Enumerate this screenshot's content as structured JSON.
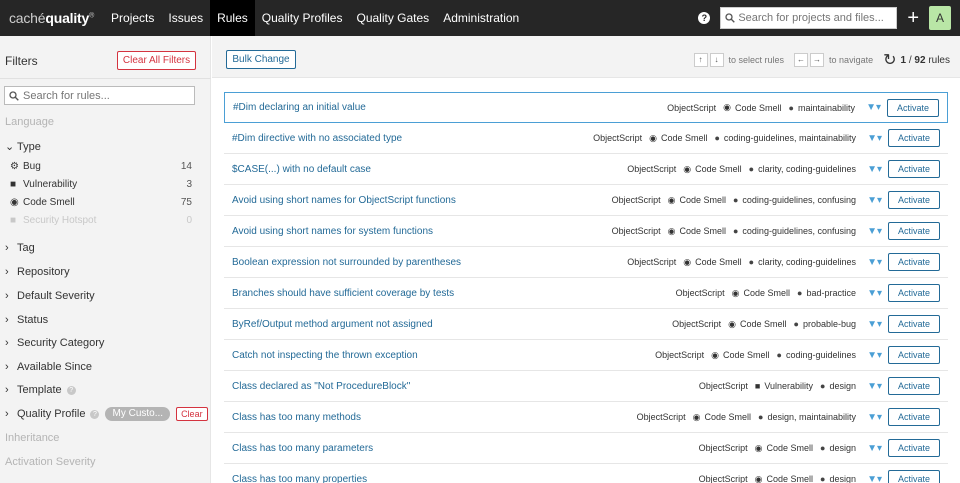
{
  "nav": {
    "logo_light": "caché",
    "logo_bold": "quality",
    "logo_sup": "®",
    "links": [
      "Projects",
      "Issues",
      "Rules",
      "Quality Profiles",
      "Quality Gates",
      "Administration"
    ],
    "active": "Rules",
    "search_placeholder": "Search for projects and files...",
    "help_icon": "?",
    "plus_icon": "+",
    "avatar_letter": "A"
  },
  "sidebar": {
    "filters_label": "Filters",
    "clear_all_label": "Clear All Filters",
    "search_placeholder": "Search for rules...",
    "language_label": "Language",
    "type_label": "Type",
    "type_items": [
      {
        "label": "Bug",
        "count": "14",
        "icon": "bug-icon"
      },
      {
        "label": "Vulnerability",
        "count": "3",
        "icon": "lock-icon"
      },
      {
        "label": "Code Smell",
        "count": "75",
        "icon": "code-smell-icon"
      },
      {
        "label": "Security Hotspot",
        "count": "0",
        "icon": "hotspot-icon"
      }
    ],
    "tag_label": "Tag",
    "repository_label": "Repository",
    "default_severity_label": "Default Severity",
    "status_label": "Status",
    "security_category_label": "Security Category",
    "available_since_label": "Available Since",
    "template_label": "Template",
    "quality_profile_label": "Quality Profile",
    "quality_profile_value": "My Custo...",
    "quality_profile_clear": "Clear",
    "inheritance_label": "Inheritance",
    "activation_severity_label": "Activation Severity"
  },
  "toolbar": {
    "bulk_change_label": "Bulk Change",
    "select_hint": "to select rules",
    "navigate_hint": "to navigate",
    "up_key": "↑",
    "down_key": "↓",
    "left_key": "←",
    "right_key": "→",
    "count_current": "1",
    "count_total": "92",
    "count_suffix": "rules"
  },
  "rules": [
    {
      "title": "#Dim declaring an initial value",
      "lang": "ObjectScript",
      "type": "Code Smell",
      "tags": "maintainability",
      "action": "Activate"
    },
    {
      "title": "#Dim directive with no associated type",
      "lang": "ObjectScript",
      "type": "Code Smell",
      "tags": "coding-guidelines, maintainability",
      "action": "Activate"
    },
    {
      "title": "$CASE(...) with no default case",
      "lang": "ObjectScript",
      "type": "Code Smell",
      "tags": "clarity, coding-guidelines",
      "action": "Activate"
    },
    {
      "title": "Avoid using short names for ObjectScript functions",
      "lang": "ObjectScript",
      "type": "Code Smell",
      "tags": "coding-guidelines, confusing",
      "action": "Activate"
    },
    {
      "title": "Avoid using short names for system functions",
      "lang": "ObjectScript",
      "type": "Code Smell",
      "tags": "coding-guidelines, confusing",
      "action": "Activate"
    },
    {
      "title": "Boolean expression not surrounded by parentheses",
      "lang": "ObjectScript",
      "type": "Code Smell",
      "tags": "clarity, coding-guidelines",
      "action": "Activate"
    },
    {
      "title": "Branches should have sufficient coverage by tests",
      "lang": "ObjectScript",
      "type": "Code Smell",
      "tags": "bad-practice",
      "action": "Activate"
    },
    {
      "title": "ByRef/Output method argument not assigned",
      "lang": "ObjectScript",
      "type": "Code Smell",
      "tags": "probable-bug",
      "action": "Activate"
    },
    {
      "title": "Catch not inspecting the thrown exception",
      "lang": "ObjectScript",
      "type": "Code Smell",
      "tags": "coding-guidelines",
      "action": "Activate"
    },
    {
      "title": "Class declared as \"Not ProcedureBlock\"",
      "lang": "ObjectScript",
      "type": "Vulnerability",
      "tags": "design",
      "action": "Activate"
    },
    {
      "title": "Class has too many methods",
      "lang": "ObjectScript",
      "type": "Code Smell",
      "tags": "design, maintainability",
      "action": "Activate"
    },
    {
      "title": "Class has too many parameters",
      "lang": "ObjectScript",
      "type": "Code Smell",
      "tags": "design",
      "action": "Activate"
    },
    {
      "title": "Class has too many properties",
      "lang": "ObjectScript",
      "type": "Code Smell",
      "tags": "design",
      "action": "Activate"
    }
  ],
  "colors": {
    "nav_bg": "#262626",
    "link_blue": "#236a97",
    "danger_red": "#d4333f",
    "selected_border": "#4b9fd5"
  }
}
